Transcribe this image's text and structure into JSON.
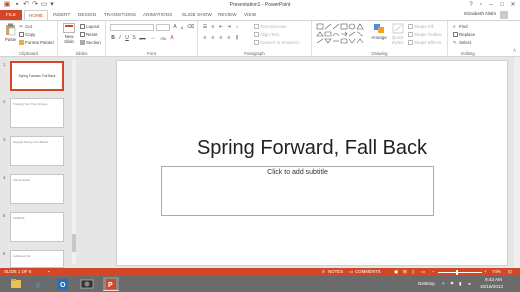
{
  "app": {
    "window_title": "Presentation1 - PowerPoint"
  },
  "tabs": [
    "FILE",
    "HOME",
    "INSERT",
    "DESIGN",
    "TRANSITIONS",
    "ANIMATIONS",
    "SLIDE SHOW",
    "REVIEW",
    "VIEW"
  ],
  "active_tab": "HOME",
  "user": {
    "name": "Elizabeth Nishi"
  },
  "ribbon": {
    "clipboard": {
      "label": "Clipboard",
      "paste": "Paste",
      "cut": "Cut",
      "copy": "Copy",
      "format_painter": "Format Painter"
    },
    "slides": {
      "label": "Slides",
      "new_slide_line1": "New",
      "new_slide_line2": "Slide",
      "layout": "Layout",
      "reset": "Reset",
      "section": "Section"
    },
    "font": {
      "label": "Font",
      "bold": "B",
      "italic": "I",
      "underline": "U",
      "shadow": "S",
      "strike": "abc",
      "case": "Aa"
    },
    "paragraph": {
      "label": "Paragraph",
      "text_direction": "Text Direction",
      "align_text": "Align Text",
      "convert_smartart": "Convert to SmartArt"
    },
    "drawing": {
      "label": "Drawing",
      "arrange": "Arrange",
      "quick_styles_line1": "Quick",
      "quick_styles_line2": "Styles",
      "shape_fill": "Shape Fill",
      "shape_outline": "Shape Outline",
      "shape_effects": "Shape Effects"
    },
    "editing": {
      "label": "Editing",
      "find": "Find",
      "replace": "Replace",
      "select": "Select"
    }
  },
  "slide": {
    "title": "Spring Forward, Fall Back",
    "subtitle_placeholder": "Click to add subtitle"
  },
  "thumbnails": [
    {
      "num": "1",
      "text": "Spring Forward, Fall Back",
      "selected": true
    },
    {
      "num": "2",
      "text": "Tracking Your Time Change",
      "selected": false
    },
    {
      "num": "3",
      "text": "Daylight Saving Time Basics",
      "selected": false
    },
    {
      "num": "4",
      "text": "Spring Ahead",
      "selected": false
    },
    {
      "num": "5",
      "text": "Fall Back",
      "selected": false
    },
    {
      "num": "6",
      "text": "Additional Info",
      "selected": false
    }
  ],
  "statusbar": {
    "slide_indicator": "SLIDE 1 OF 6",
    "notes": "NOTES",
    "comments": "COMMENTS",
    "zoom": "74%"
  },
  "taskbar": {
    "desktop": "Desktop",
    "time": "9:43 AM",
    "date": "10/16/2013"
  },
  "colors": {
    "accent": "#d24726",
    "ribbon_bg": "#ffffff",
    "workspace_bg": "#e6e6e6",
    "taskbar_bg": "#6b6b6b"
  }
}
